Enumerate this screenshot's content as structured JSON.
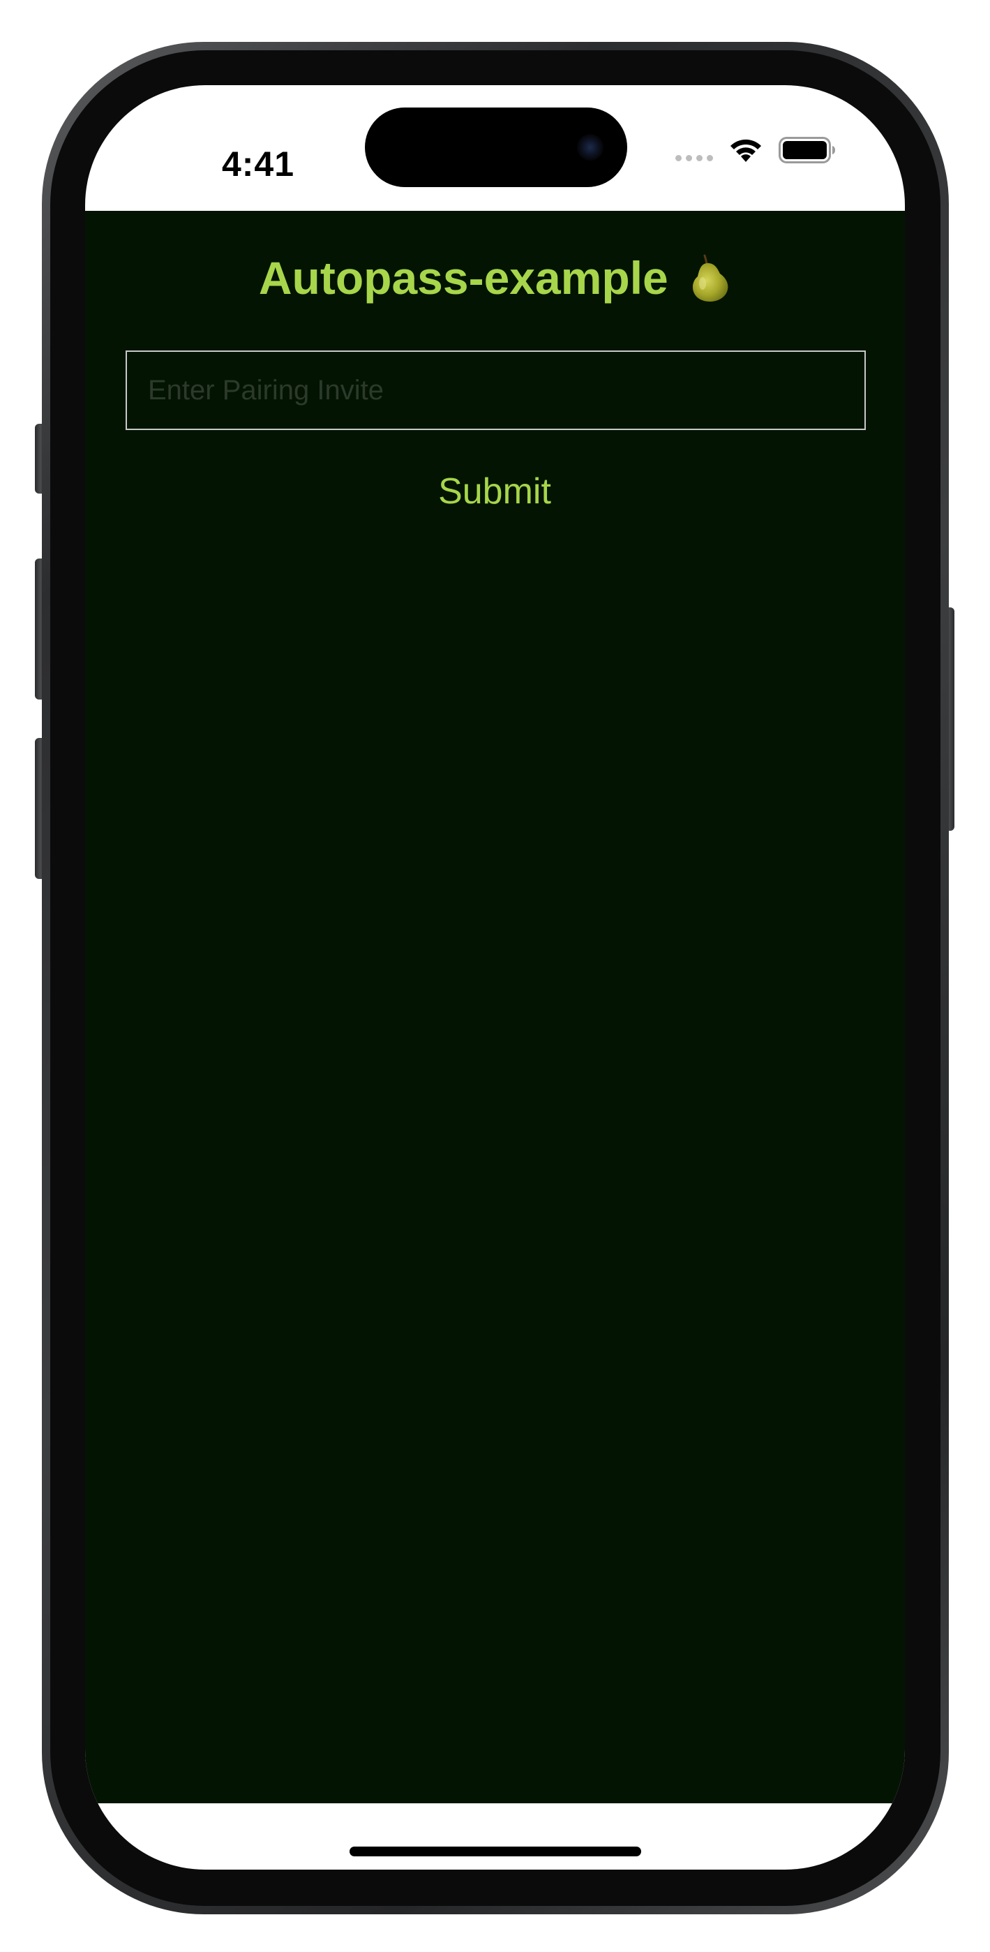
{
  "status_bar": {
    "time": "4:41",
    "signal_icon": "cellular-signal-icon",
    "wifi_icon": "wifi-icon",
    "battery_icon": "battery-icon"
  },
  "app": {
    "title": "Autopass-example",
    "title_icon": "pear-icon",
    "invite_input": {
      "value": "",
      "placeholder": "Enter Pairing Invite"
    },
    "submit_label": "Submit"
  },
  "colors": {
    "background": "#041403",
    "accent": "#a7d64b",
    "input_border": "#c9c9c9"
  }
}
